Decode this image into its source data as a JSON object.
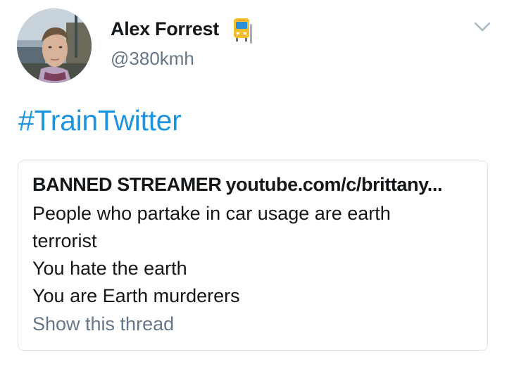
{
  "tweet": {
    "author": {
      "display_name": "Alex Forrest",
      "emoji": "tram-emoji",
      "handle": "@380kmh"
    },
    "text": "#TrainTwitter",
    "menu_icon": "chevron-down-icon"
  },
  "quoted_tweet": {
    "author_name": "BANNED STREAMER",
    "author_handle": "youtube.com/c/brittany...",
    "lines": [
      "People who partake in car usage are earth",
      "terrorist",
      "You hate the earth",
      "You are Earth murderers"
    ],
    "show_thread_label": "Show this thread"
  },
  "colors": {
    "link": "#1b95e0",
    "secondary_text": "#657786",
    "border": "#dfe4e8",
    "primary_text": "#14171a"
  }
}
